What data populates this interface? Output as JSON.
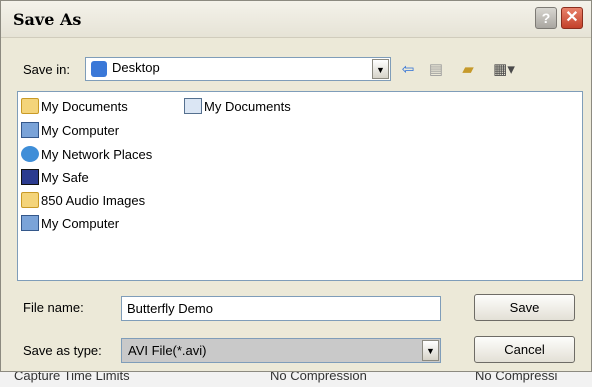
{
  "window": {
    "title": "Save As",
    "help_glyph": "?",
    "close_glyph": "✕"
  },
  "location": {
    "label": "Save in:",
    "value": "Desktop"
  },
  "toolbar": {
    "icons": [
      "back-arrow-icon",
      "up-folder-icon",
      "new-folder-icon",
      "view-menu-icon"
    ]
  },
  "files": [
    {
      "name": "My Documents",
      "icon": "my-documents-icon"
    },
    {
      "name": "My Computer",
      "icon": "my-computer-icon"
    },
    {
      "name": "My Network Places",
      "icon": "network-places-icon"
    },
    {
      "name": "My Safe",
      "icon": "safe-icon"
    },
    {
      "name": "850 Audio Images",
      "icon": "folder-icon"
    },
    {
      "name": "My Computer",
      "icon": "computer-shortcut-icon"
    },
    {
      "name": "My Documents",
      "icon": "documents-shortcut-icon"
    }
  ],
  "filename": {
    "label": "File name:",
    "value": "Butterfly Demo"
  },
  "filetype": {
    "label": "Save as type:",
    "value": "AVI File(*.avi)"
  },
  "buttons": {
    "save": "Save",
    "cancel": "Cancel"
  },
  "background_strip": [
    "Capture Time Limits",
    "No Compression",
    "No Compressi"
  ]
}
